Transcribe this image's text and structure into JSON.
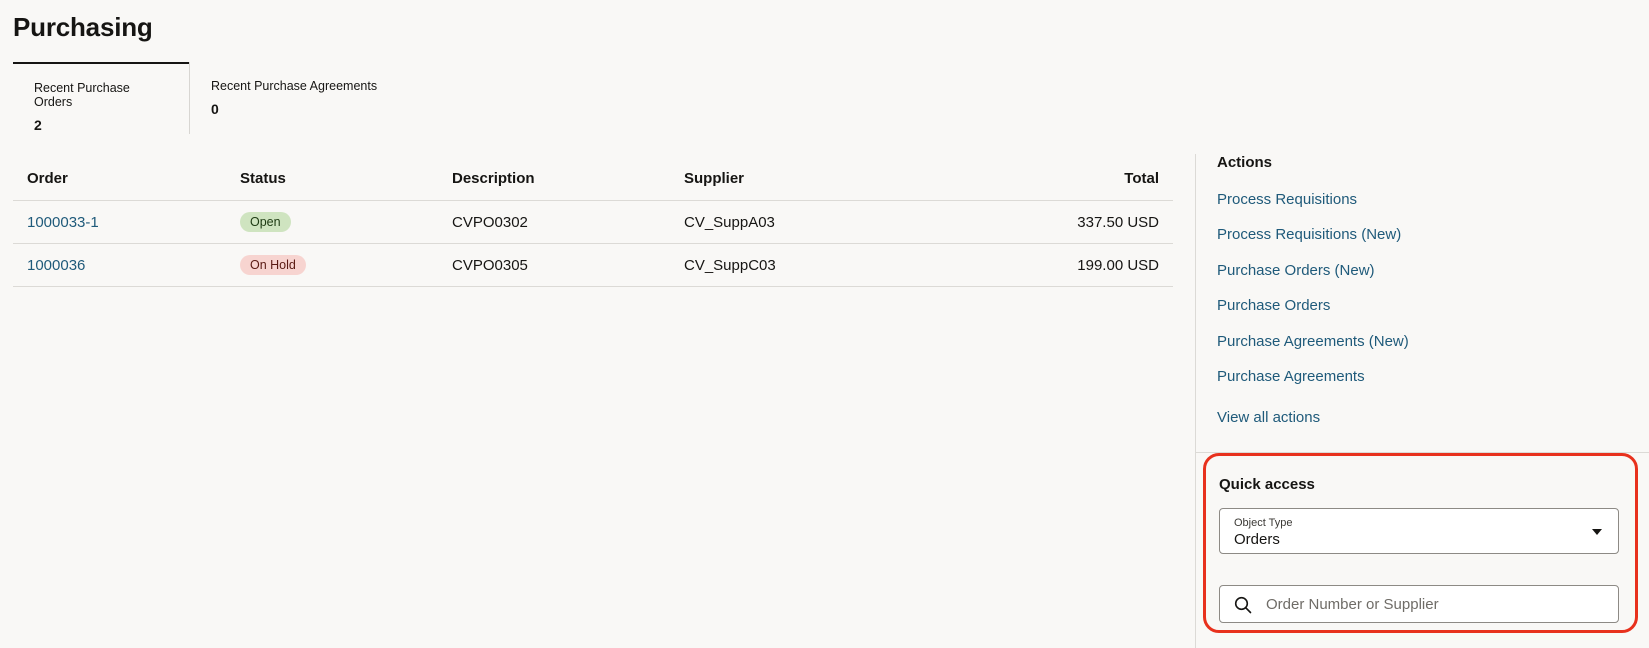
{
  "page": {
    "title": "Purchasing"
  },
  "tabs": [
    {
      "label": "Recent Purchase Orders",
      "count": "2"
    },
    {
      "label": "Recent Purchase Agreements",
      "count": "0"
    }
  ],
  "table": {
    "headers": {
      "order": "Order",
      "status": "Status",
      "description": "Description",
      "supplier": "Supplier",
      "total": "Total"
    },
    "rows": [
      {
        "order": "1000033-1",
        "status": "Open",
        "description": "CVPO0302",
        "supplier": "CV_SuppA03",
        "total": "337.50 USD"
      },
      {
        "order": "1000036",
        "status": "On Hold",
        "description": "CVPO0305",
        "supplier": "CV_SuppC03",
        "total": "199.00 USD"
      }
    ]
  },
  "actions": {
    "title": "Actions",
    "items": [
      "Process Requisitions",
      "Process Requisitions (New)",
      "Purchase Orders (New)",
      "Purchase Orders",
      "Purchase Agreements (New)",
      "Purchase Agreements"
    ],
    "view_all": "View all actions"
  },
  "quick_access": {
    "title": "Quick access",
    "object_type_label": "Object Type",
    "object_type_value": "Orders",
    "search_placeholder": "Order Number or Supplier"
  },
  "colors": {
    "link": "#1f5a7a",
    "highlight_border": "#e8311d",
    "badge_open": "#cfe4c0",
    "badge_on_hold": "#f7d4d0"
  },
  "icons": {
    "search": "search-icon",
    "dropdown": "chevron-down-icon"
  }
}
